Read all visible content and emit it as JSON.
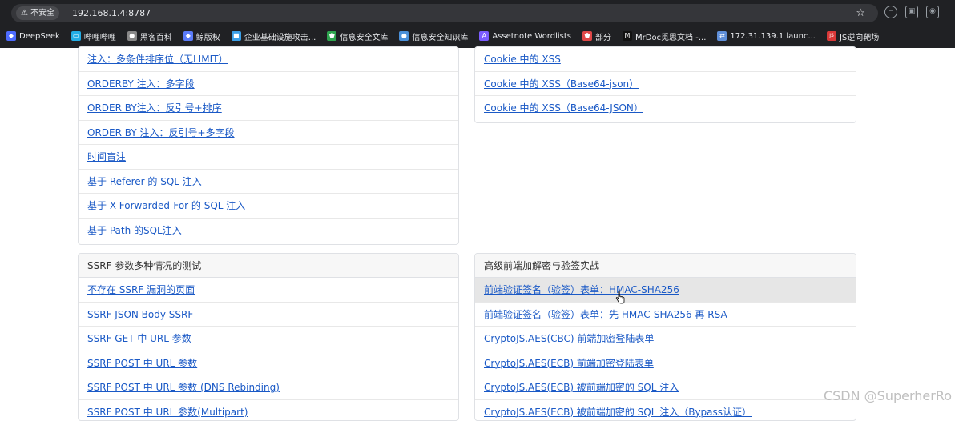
{
  "browser": {
    "security_label": "不安全",
    "url": "192.168.1.4:8787",
    "bookmarks": [
      {
        "label": "DeepSeek",
        "icon": "whale-icon",
        "color": "#4d6bfe"
      },
      {
        "label": "哔哩哔哩",
        "icon": "tv-icon",
        "color": "#23ade5"
      },
      {
        "label": "黑客百科",
        "icon": "globe-icon",
        "color": "#888888"
      },
      {
        "label": "鲸版权",
        "icon": "whale-icon",
        "color": "#5b7cfa"
      },
      {
        "label": "企业基础设施攻击...",
        "icon": "cube-icon",
        "color": "#3ca0e8"
      },
      {
        "label": "信息安全文库",
        "icon": "shield-icon",
        "color": "#2da44e"
      },
      {
        "label": "信息安全知识库",
        "icon": "globe-icon",
        "color": "#4a90d9"
      },
      {
        "label": "Assetnote Wordlists",
        "icon": "a-icon",
        "color": "#7b5cff"
      },
      {
        "label": "部分",
        "icon": "shield-icon",
        "color": "#e04848"
      },
      {
        "label": "MrDoc觅思文档 -...",
        "icon": "m-icon",
        "color": "#111111"
      },
      {
        "label": "172.31.139.1 launc...",
        "icon": "network-icon",
        "color": "#5f8fd9"
      },
      {
        "label": "JS逆向靶场",
        "icon": "js-icon",
        "color": "#d93838"
      }
    ]
  },
  "left_top_panel": {
    "items": [
      "注入：多条件排序位（无LIMIT）",
      "ORDERBY 注入：多字段",
      "ORDER BY注入：反引号+排序",
      "ORDER BY 注入：反引号+多字段",
      "时间盲注",
      "基于 Referer 的 SQL 注入",
      "基于 X-Forwarded-For 的 SQL 注入",
      "基于 Path 的SQL注入"
    ]
  },
  "right_top_panel": {
    "items": [
      "Cookie 中的 XSS",
      "Cookie 中的 XSS（Base64-json）",
      "Cookie 中的 XSS（Base64-JSON）"
    ]
  },
  "ssrf_panel": {
    "title": "SSRF 参数多种情况的测试",
    "items": [
      "不存在 SSRF 漏洞的页面",
      "SSRF JSON Body SSRF",
      "SSRF GET 中 URL 参数",
      "SSRF POST 中 URL 参数",
      "SSRF POST 中 URL 参数 (DNS Rebinding)",
      "SSRF POST 中 URL 参数(Multipart)"
    ]
  },
  "crypto_panel": {
    "title": "高级前端加解密与验签实战",
    "items": [
      "前端验证签名（验签）表单：HMAC-SHA256",
      "前端验证签名（验签）表单：先 HMAC-SHA256 再 RSA",
      "CryptoJS.AES(CBC) 前端加密登陆表单",
      "CryptoJS.AES(ECB) 前端加密登陆表单",
      "CryptoJS.AES(ECB) 被前端加密的 SQL 注入",
      "CryptoJS.AES(ECB) 被前端加密的 SQL 注入（Bypass认证）"
    ]
  },
  "watermark": "CSDN @SuperherRo"
}
